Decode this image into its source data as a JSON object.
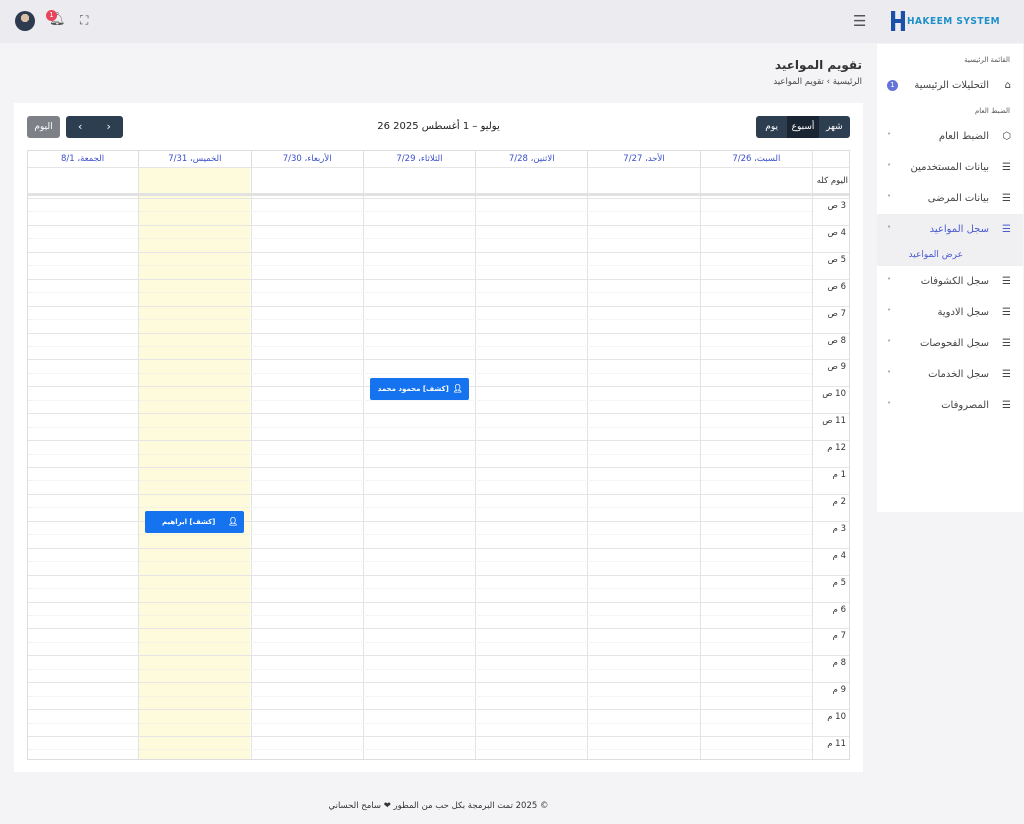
{
  "topbar": {
    "notification_count": "1",
    "brand": "HAKEEM SYSTEM"
  },
  "sidebar": {
    "section_main": "القائمة الرئيسية",
    "dashboard": {
      "label": "التحليلات الرئيسية",
      "count": "1"
    },
    "section_settings": "الضبط العام",
    "items": [
      {
        "label": "الضبط العام",
        "icon": "box-icon"
      },
      {
        "label": "بيانات المستخدمين",
        "icon": "list-icon"
      },
      {
        "label": "بيانات المرضى",
        "icon": "list-icon"
      },
      {
        "label": "سجل المواعيد",
        "icon": "list-icon",
        "active": true
      },
      {
        "label": "سجل الكشوفات",
        "icon": "list-icon"
      },
      {
        "label": "سجل الادوية",
        "icon": "list-icon"
      },
      {
        "label": "سجل الفحوصات",
        "icon": "list-icon"
      },
      {
        "label": "سجل الخدمات",
        "icon": "list-icon"
      },
      {
        "label": "المصروفات",
        "icon": "list-icon"
      }
    ],
    "subitem": "عرض المواعيد"
  },
  "page": {
    "title": "تقويم المواعيد",
    "breadcrumb": [
      "الرئيسية",
      "تقويم المواعيد"
    ]
  },
  "calendar": {
    "today_label": "اليوم",
    "views": [
      "شهر",
      "أسبوع",
      "يوم"
    ],
    "active_view": "أسبوع",
    "range": "26 يوليو – 1 أغسطس 2025",
    "days": [
      "السبت، 7/26",
      "الأحد، 7/27",
      "الاثنين، 7/28",
      "الثلاثاء، 7/29",
      "الأربعاء، 7/30",
      "الخميس، 7/31",
      "الجمعة، 8/1"
    ],
    "highlight_day": "الخميس، 7/31",
    "allday_label": "اليوم كله",
    "hours": [
      "3 ص",
      "4 ص",
      "5 ص",
      "6 ص",
      "7 ص",
      "8 ص",
      "9 ص",
      "10 ص",
      "11 ص",
      "12 م",
      "1 م",
      "2 م",
      "3 م",
      "4 م",
      "5 م",
      "6 م",
      "7 م",
      "8 م",
      "9 م",
      "10 م",
      "11 م"
    ],
    "events": [
      {
        "day": "الثلاثاء، 7/29",
        "hour": "10 ص",
        "title": "[كشف] محمود محمد محمود",
        "color": "#1673f0"
      },
      {
        "day": "الخميس، 7/31",
        "hour": "3 م",
        "title": "[كشف] ابراهيم عبدالرحيم علي",
        "color": "#1673f0"
      }
    ]
  },
  "footer": "© 2025 تمت البرمجة بكل حب من المطور ❤ سامح الحساني",
  "colors": {
    "accent": "#4a5bd0",
    "event": "#1673f0",
    "dark_button": "#2c3e50",
    "highlight": "#fefbdc"
  }
}
